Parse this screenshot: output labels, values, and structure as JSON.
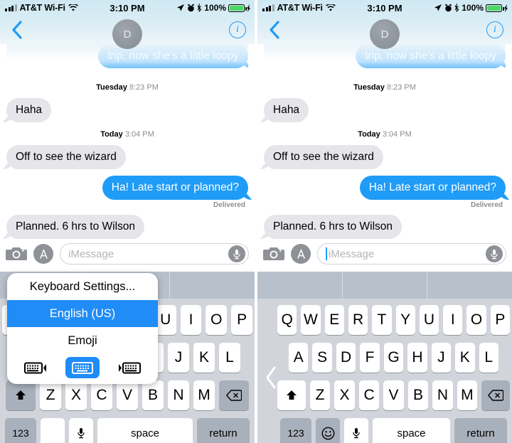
{
  "status_bar": {
    "carrier": "AT&T Wi-Fi",
    "time": "3:10 PM",
    "battery_percent": "100%",
    "icons": [
      "signal-bars-icon",
      "wifi-icon",
      "location-arrow-icon",
      "alarm-clock-icon",
      "bluetooth-icon",
      "battery-icon",
      "charging-bolt-icon"
    ]
  },
  "nav_bar": {
    "back_icon": "chevron-left-icon",
    "avatar_initial": "D",
    "info_icon": "info-circle-icon"
  },
  "conversation": {
    "messages": [
      {
        "text": "trip, now she's a little loopy",
        "side": "me",
        "faded": true
      },
      {
        "text": "Haha",
        "side": "them"
      },
      {
        "text": "Off to see the wizard",
        "side": "them"
      },
      {
        "text": "Ha! Late start or planned?",
        "side": "me"
      },
      {
        "text": "Planned. 6 hrs to Wilson",
        "side": "them"
      }
    ],
    "timestamps": [
      {
        "day": "Tuesday",
        "time": "8:23 PM"
      },
      {
        "day": "Today",
        "time": "3:04 PM"
      }
    ],
    "delivered_label": "Delivered"
  },
  "input_bar": {
    "camera_icon": "camera-icon",
    "appstore_icon": "app-store-icon",
    "placeholder": "iMessage",
    "mic_icon": "microphone-icon"
  },
  "keyboard": {
    "row1": [
      "Q",
      "W",
      "E",
      "R",
      "T",
      "Y",
      "U",
      "I",
      "O",
      "P"
    ],
    "row2": [
      "A",
      "S",
      "D",
      "F",
      "G",
      "H",
      "J",
      "K",
      "L"
    ],
    "row3": [
      "Z",
      "X",
      "C",
      "V",
      "B",
      "N",
      "M"
    ],
    "shift_icon": "shift-arrow-icon",
    "backspace_icon": "backspace-icon",
    "numbers_label": "123",
    "emoji_icon": "smiley-face-icon",
    "dictation_icon": "microphone-icon",
    "space_label": "space",
    "return_label": "return",
    "one_handed_handle_icon": "chevron-left-icon"
  },
  "keyboard_popup": {
    "settings_label": "Keyboard Settings...",
    "selected_language": "English (US)",
    "emoji_label": "Emoji",
    "modes": [
      {
        "name": "keyboard-left-icon",
        "selected": false
      },
      {
        "name": "keyboard-center-icon",
        "selected": true
      },
      {
        "name": "keyboard-right-icon",
        "selected": false
      }
    ]
  },
  "colors": {
    "accent_blue": "#1f9cf7",
    "popup_selected": "#1f8cf7",
    "bubble_gray": "#e5e5ea",
    "keyboard_bg": "#d1d5db",
    "predictive_bg": "#b8c0cc",
    "key_dark": "#a8b0bb",
    "battery_green": "#4cd964"
  }
}
